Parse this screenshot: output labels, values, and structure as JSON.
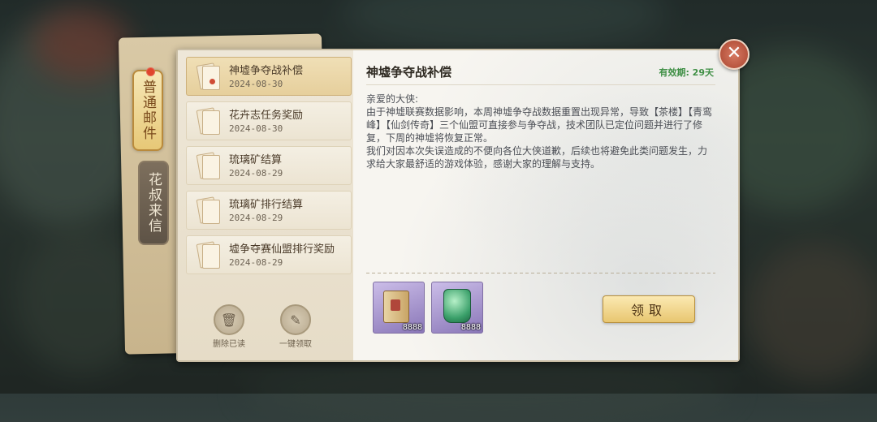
{
  "tabs": [
    {
      "label": "普通邮件",
      "active": true,
      "has_badge": true
    },
    {
      "label": "花叔来信",
      "active": false
    }
  ],
  "mail_list": [
    {
      "title": "神墟争夺战补偿",
      "date": "2024-08-30",
      "selected": true
    },
    {
      "title": "花卉志任务奖励",
      "date": "2024-08-30",
      "selected": false
    },
    {
      "title": "琉璃矿结算",
      "date": "2024-08-29",
      "selected": false
    },
    {
      "title": "琉璃矿排行结算",
      "date": "2024-08-29",
      "selected": false
    },
    {
      "title": "墟争夺赛仙盟排行奖励",
      "date": "2024-08-29",
      "selected": false
    }
  ],
  "actions": {
    "delete_read": "删除已读",
    "claim_all": "一键领取"
  },
  "detail": {
    "title": "神墟争夺战补偿",
    "validity": "有效期: 29天",
    "greeting": "亲爱的大侠:",
    "paragraph1": "由于神墟联赛数据影响，本周神墟争夺战数据重置出现异常，导致【茶楼】【青鸾峰】【仙剑传奇】三个仙盟可直接参与争夺战，技术团队已定位问题并进行了修复，下周的神墟将恢复正常。",
    "paragraph2": "我们对因本次失误造成的不便向各位大侠道歉，后续也将避免此类问题发生，力求给大家最舒适的游戏体验，感谢大家的理解与支持。",
    "rewards": [
      {
        "icon": "scroll-icon",
        "count": "8888"
      },
      {
        "icon": "jade-token-icon",
        "count": "8888"
      }
    ],
    "claim_label": "领取"
  },
  "close_label": "✕",
  "colors": {
    "validity": "#3f8f45",
    "badge": "#e0452c",
    "claim_button": "#e8c670"
  }
}
